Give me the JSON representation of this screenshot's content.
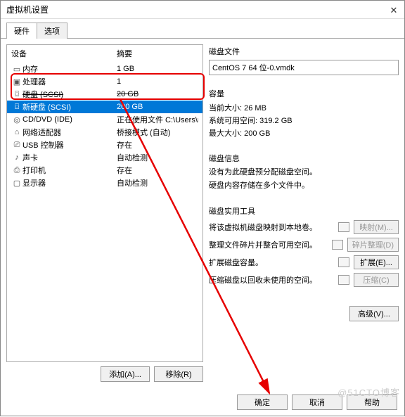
{
  "window": {
    "title": "虚拟机设置"
  },
  "tabs": {
    "hardware": "硬件",
    "options": "选项"
  },
  "device_headers": {
    "device": "设备",
    "summary": "摘要"
  },
  "devices": [
    {
      "icon": "▭",
      "name": "内存",
      "summary": "1 GB"
    },
    {
      "icon": "▣",
      "name": "处理器",
      "summary": "1"
    },
    {
      "icon": "⌼",
      "name": "硬盘 (SCSI)",
      "summary": "20 GB",
      "strike": true
    },
    {
      "icon": "⌼",
      "name": "新硬盘 (SCSI)",
      "summary": "200 GB",
      "selected": true
    },
    {
      "icon": "◎",
      "name": "CD/DVD (IDE)",
      "summary": "正在使用文件 C:\\Users\\root\\De..."
    },
    {
      "icon": "⌂",
      "name": "网络适配器",
      "summary": "桥接模式 (自动)"
    },
    {
      "icon": "�खE",
      "name": "USB 控制器",
      "summary": "存在"
    },
    {
      "icon": "♪",
      "name": "声卡",
      "summary": "自动检测"
    },
    {
      "icon": "⎙",
      "name": "打印机",
      "summary": "存在"
    },
    {
      "icon": "▢",
      "name": "显示器",
      "summary": "自动检测"
    }
  ],
  "left_buttons": {
    "add": "添加(A)...",
    "remove": "移除(R)"
  },
  "disk_file": {
    "title": "磁盘文件",
    "value": "CentOS 7 64 位-0.vmdk"
  },
  "capacity": {
    "title": "容量",
    "current": "当前大小: 26 MB",
    "free": "系统可用空间: 319.2 GB",
    "max": "最大大小: 200 GB"
  },
  "disk_info": {
    "title": "磁盘信息",
    "line1": "没有为此硬盘预分配磁盘空间。",
    "line2": "硬盘内容存储在多个文件中。"
  },
  "tools": {
    "title": "磁盘实用工具",
    "map_label": "将该虚拟机磁盘映射到本地卷。",
    "map_btn": "映射(M)...",
    "defrag_label": "整理文件碎片并整合可用空间。",
    "defrag_btn": "碎片整理(D)",
    "expand_label": "扩展磁盘容量。",
    "expand_btn": "扩展(E)...",
    "compact_label": "压缩磁盘以回收未使用的空间。",
    "compact_btn": "压缩(C)"
  },
  "advanced_btn": "高级(V)...",
  "footer": {
    "ok": "确定",
    "cancel": "取消",
    "help": "帮助"
  },
  "icons": {
    "usb": "�názE"
  }
}
